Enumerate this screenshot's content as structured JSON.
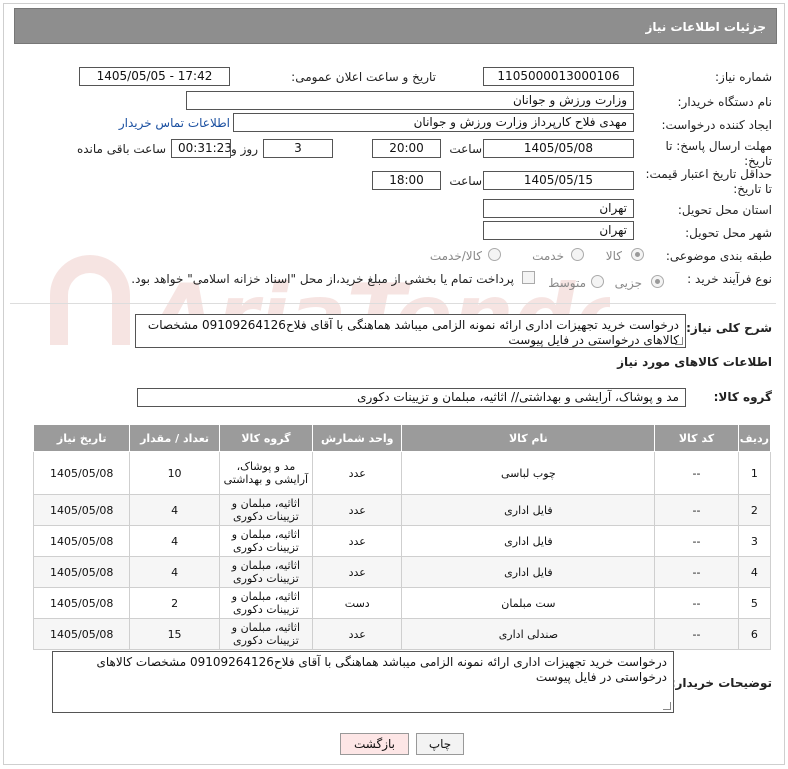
{
  "header": {
    "title": "جزئیات اطلاعات نیاز"
  },
  "fields": {
    "need_number_label": "شماره نیاز:",
    "need_number": "1105000013000106",
    "announce_label": "تاریخ و ساعت اعلان عمومی:",
    "announce_value": "1405/05/05 - 17:42",
    "buyer_org_label": "نام دستگاه خریدار:",
    "buyer_org": "وزارت ورزش و جوانان",
    "creator_label": "ایجاد کننده درخواست:",
    "creator": "مهدی فلاح کارپرداز وزارت ورزش و جوانان",
    "contact_link": "اطلاعات تماس خریدار",
    "deadline_label_1": "مهلت ارسال پاسخ: تا",
    "deadline_label_2": "تاریخ:",
    "deadline_date": "1405/05/08",
    "time_label": "ساعت",
    "deadline_time": "20:00",
    "days_value": "3",
    "days_label": "روز و",
    "remaining_time": "00:31:23",
    "remaining_label": "ساعت باقی مانده",
    "price_label_1": "حداقل تاریخ اعتبار قیمت:",
    "price_label_2": "تا تاریخ:",
    "price_date": "1405/05/15",
    "price_time": "18:00",
    "province_label": "استان محل تحویل:",
    "province": "تهران",
    "city_label": "شهر محل تحویل:",
    "city": "تهران",
    "category_label": "طبقه بندی موضوعی:",
    "category_options": [
      "کالا",
      "خدمت",
      "کالا/خدمت"
    ],
    "process_label": "نوع فرآیند خرید :",
    "process_options": [
      "جزیی",
      "متوسط"
    ],
    "payment_text": "پرداخت تمام یا بخشی از مبلغ خرید،از محل \"اسناد خزانه اسلامی\" خواهد بود."
  },
  "description": {
    "label": "شرح کلی نیاز:",
    "text": "درخواست خرید تجهیزات اداری ارائه نمونه الزامی میباشد  هماهنگی با آقای فلاح09109264126 مشخصات کالاهای درخواستی در فایل پیوست"
  },
  "goods_info": {
    "title": "اطلاعات کالاهای مورد نیاز",
    "group_label": "گروه کالا:",
    "group_value": "مد و پوشاک، آرایشی و بهداشتی// اثاثیه، مبلمان و تزیینات دکوری"
  },
  "table": {
    "headers": [
      "ردیف",
      "کد کالا",
      "نام کالا",
      "واحد شمارش",
      "گروه کالا",
      "تعداد / مقدار",
      "تاریخ نیاز"
    ],
    "rows": [
      {
        "row": "1",
        "code": "--",
        "name": "چوب لباسی",
        "unit": "عدد",
        "group": "مد و پوشاک، آرایشی و بهداشتی",
        "qty": "10",
        "date": "1405/05/08"
      },
      {
        "row": "2",
        "code": "--",
        "name": "فایل اداری",
        "unit": "عدد",
        "group": "اثاثیه، مبلمان و تزیینات دکوری",
        "qty": "4",
        "date": "1405/05/08"
      },
      {
        "row": "3",
        "code": "--",
        "name": "فایل اداری",
        "unit": "عدد",
        "group": "اثاثیه، مبلمان و تزیینات دکوری",
        "qty": "4",
        "date": "1405/05/08"
      },
      {
        "row": "4",
        "code": "--",
        "name": "فایل اداری",
        "unit": "عدد",
        "group": "اثاثیه، مبلمان و تزیینات دکوری",
        "qty": "4",
        "date": "1405/05/08"
      },
      {
        "row": "5",
        "code": "--",
        "name": "ست مبلمان",
        "unit": "دست",
        "group": "اثاثیه، مبلمان و تزیینات دکوری",
        "qty": "2",
        "date": "1405/05/08"
      },
      {
        "row": "6",
        "code": "--",
        "name": "صندلی اداری",
        "unit": "عدد",
        "group": "اثاثیه، مبلمان و تزیینات دکوری",
        "qty": "15",
        "date": "1405/05/08"
      }
    ]
  },
  "buyer_notes": {
    "label": "توضیحات خریدار:",
    "text": "درخواست خرید تجهیزات اداری ارائه نمونه الزامی میباشد  هماهنگی با آقای فلاح09109264126 مشخصات کالاهای درخواستی در فایل پیوست"
  },
  "buttons": {
    "print": "چاپ",
    "back": "بازگشت"
  },
  "watermark": {
    "text": "AriaTender.neT",
    "color": "#c0392b"
  }
}
